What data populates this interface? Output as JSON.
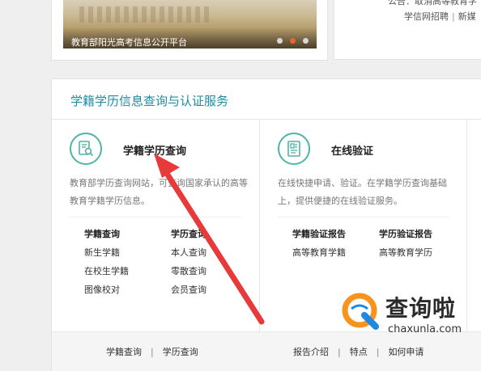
{
  "banner": {
    "caption": "教育部阳光高考信息公开平台",
    "dots": 3,
    "active_dot": 2
  },
  "notice": {
    "top_text": "公告：取消高等教育学",
    "links": [
      "学信网招聘",
      "新媒"
    ]
  },
  "panel": {
    "title": "学籍学历信息查询与认证服务",
    "services": [
      {
        "name": "学籍学历查询",
        "icon": "certificate-search-icon",
        "desc": "教育部学历查询网站，可查询国家承认的高等教育学籍学历信息。",
        "groups": [
          {
            "header": "学籍查询",
            "items": [
              "新生学籍",
              "在校生学籍",
              "图像校对"
            ]
          },
          {
            "header": "学历查询",
            "items": [
              "本人查询",
              "零散查询",
              "会员查询"
            ]
          }
        ],
        "footer": [
          "学籍查询",
          "学历查询"
        ]
      },
      {
        "name": "在线验证",
        "icon": "document-verify-icon",
        "desc": "在线快捷申请、验证。在学籍学历查询基础上，提供便捷的在线验证服务。",
        "groups": [
          {
            "header": "学籍验证报告",
            "items": [
              "高等教育学籍"
            ]
          },
          {
            "header": "学历验证报告",
            "items": [
              "高等教育学历"
            ]
          }
        ],
        "footer": [
          "报告介绍",
          "特点",
          "如何申请"
        ]
      }
    ]
  },
  "footer_separator": "|",
  "watermark": {
    "title": "查询啦",
    "domain": "chaxunla.com"
  },
  "colors": {
    "accent": "#1c8ca0",
    "icon": "#4fb4a8",
    "arrow": "#e8393b",
    "active_dot": "#f0612b",
    "watermark_orange": "#f7941d",
    "watermark_blue": "#1e88e5"
  }
}
